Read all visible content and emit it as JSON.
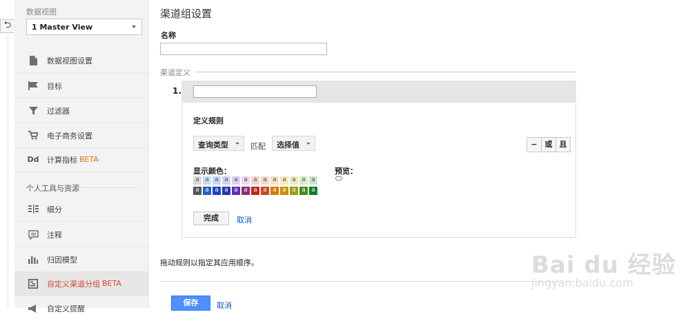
{
  "sidebar": {
    "view_label": "数据视图",
    "view_selected": "1 Master View",
    "items": [
      {
        "label": "数据视图设置",
        "icon": "document-icon"
      },
      {
        "label": "目标",
        "icon": "flag-icon"
      },
      {
        "label": "过滤器",
        "icon": "filter-icon"
      },
      {
        "label": "电子商务设置",
        "icon": "cart-icon"
      },
      {
        "label": "计算指标",
        "badge": "BETA",
        "icon": "dd-icon"
      }
    ],
    "section_title": "个人工具与资源",
    "tools": [
      {
        "label": "细分",
        "icon": "segments-icon"
      },
      {
        "label": "注释",
        "icon": "comment-icon"
      },
      {
        "label": "归因模型",
        "icon": "bar-chart-icon"
      },
      {
        "label": "自定义渠道分组",
        "badge": "BETA",
        "icon": "channel-icon",
        "active": true
      },
      {
        "label": "自定义提醒",
        "icon": "megaphone-icon"
      }
    ]
  },
  "main": {
    "title": "渠道组设置",
    "name_label": "名称",
    "name_value": "",
    "definition_label": "渠道定义",
    "rule": {
      "number": "1.",
      "input_value": "",
      "section_title": "定义规则",
      "type_dropdown": "查询类型",
      "match_label": "匹配",
      "value_dropdown": "选择值",
      "ops": [
        "−",
        "或",
        "且"
      ],
      "color_label": "显示颜色：",
      "preview_label": "预览：",
      "swatch_glyph": "a",
      "light_colors": [
        "#d9d9d9",
        "#c6d9f5",
        "#c9d4f7",
        "#cfd3f5",
        "#dcd1f5",
        "#efd5ef",
        "#f5d3d3",
        "#f7d9c9",
        "#f5dfc0",
        "#f5e7b8",
        "#e7ebc1",
        "#d7ebc8",
        "#c9e5c9"
      ],
      "dark_colors": [
        "#555555",
        "#1d63c4",
        "#1a44c9",
        "#2b34b0",
        "#5b32b5",
        "#8d2b7e",
        "#c9221e",
        "#d0461a",
        "#d57a00",
        "#c79200",
        "#9b9d12",
        "#3f8f20",
        "#137b2b"
      ],
      "done_label": "完成",
      "cancel_label": "取消"
    },
    "hint": "拖动规则以指定其应用顺序。",
    "save_label": "保存",
    "cancel_label": "取消"
  },
  "watermark": {
    "main": "Bai du 经验",
    "sub": "jingyan.baidu.com"
  }
}
